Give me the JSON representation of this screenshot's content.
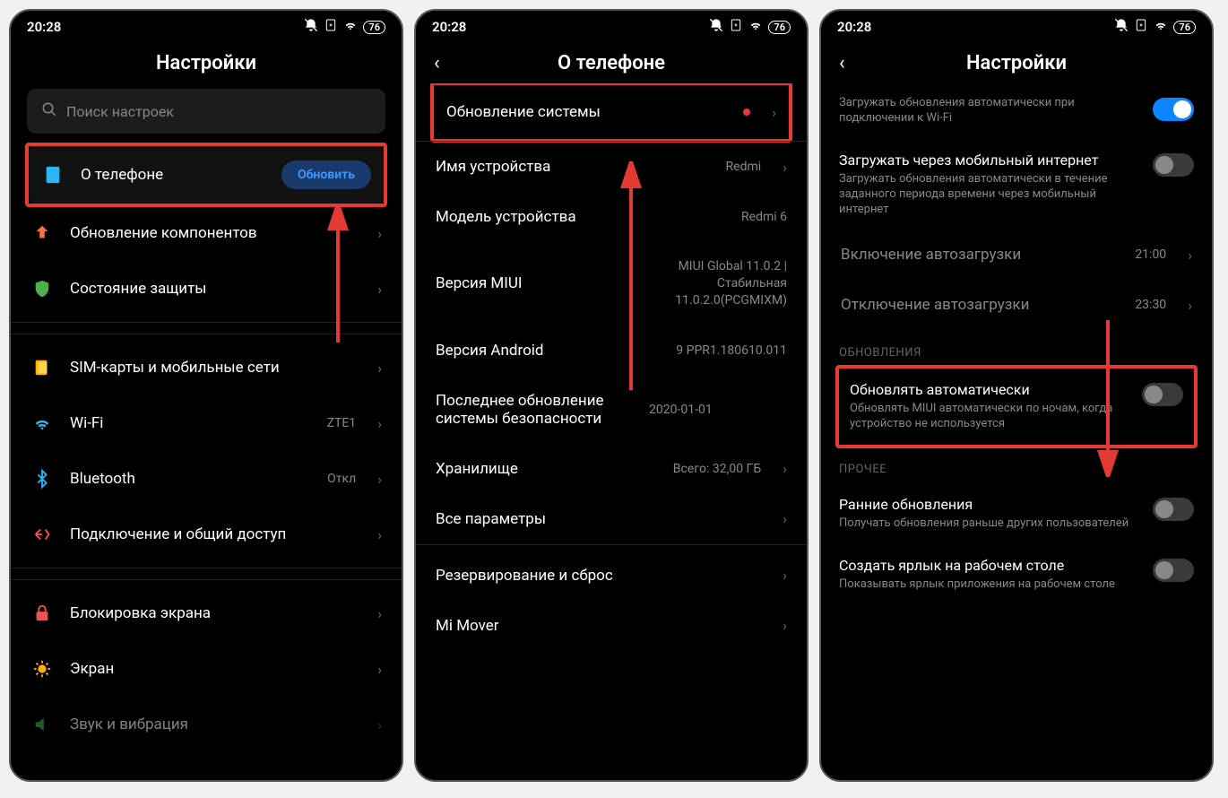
{
  "status": {
    "time": "20:28",
    "battery": "76"
  },
  "screen1": {
    "title": "Настройки",
    "search_placeholder": "Поиск настроек",
    "items": {
      "about": {
        "label": "О телефоне",
        "button": "Обновить"
      },
      "components": {
        "label": "Обновление компонентов"
      },
      "security": {
        "label": "Состояние защиты"
      },
      "sim": {
        "label": "SIM-карты и мобильные сети"
      },
      "wifi": {
        "label": "Wi-Fi",
        "value": "ZTE1"
      },
      "bluetooth": {
        "label": "Bluetooth",
        "value": "Откл"
      },
      "sharing": {
        "label": "Подключение и общий доступ"
      },
      "lock": {
        "label": "Блокировка экрана"
      },
      "display": {
        "label": "Экран"
      },
      "sound": {
        "label": "Звук и вибрация"
      }
    }
  },
  "screen2": {
    "title": "О телефоне",
    "items": {
      "system_update": {
        "label": "Обновление системы"
      },
      "device_name": {
        "label": "Имя устройства",
        "value": "Redmi"
      },
      "model": {
        "label": "Модель устройства",
        "value": "Redmi 6"
      },
      "miui": {
        "label": "Версия MIUI",
        "value": "MIUI Global 11.0.2 | Стабильная 11.0.2.0(PCGMIXM)"
      },
      "android": {
        "label": "Версия Android",
        "value": "9 PPR1.180610.011"
      },
      "security_patch": {
        "label": "Последнее обновление системы безопасности",
        "value": "2020-01-01"
      },
      "storage": {
        "label": "Хранилище",
        "value": "Всего: 32,00 ГБ"
      },
      "all_params": {
        "label": "Все параметры"
      },
      "backup": {
        "label": "Резервирование и сброс"
      },
      "mimover": {
        "label": "Mi Mover"
      }
    }
  },
  "screen3": {
    "title": "Настройки",
    "items": {
      "wifi_auto": {
        "title": "",
        "sub": "Загружать обновления автоматически при подключении к Wi-Fi"
      },
      "mobile": {
        "title": "Загружать через мобильный интернет",
        "sub": "Загружать обновления автоматически в течение заданного периода времени через мобильный интернет"
      },
      "autoload_on": {
        "title": "Включение автозагрузки",
        "value": "21:00"
      },
      "autoload_off": {
        "title": "Отключение автозагрузки",
        "value": "23:30"
      },
      "section_updates": "ОБНОВЛЕНИЯ",
      "auto_update": {
        "title": "Обновлять автоматически",
        "sub": "Обновлять MIUI автоматически по ночам, когда устройство не используется"
      },
      "section_other": "ПРОЧЕЕ",
      "early": {
        "title": "Ранние обновления",
        "sub": "Получать обновления раньше других пользователей"
      },
      "shortcut": {
        "title": "Создать ярлык на рабочем столе",
        "sub": "Показывать ярлык приложения на рабочем столе"
      }
    }
  }
}
